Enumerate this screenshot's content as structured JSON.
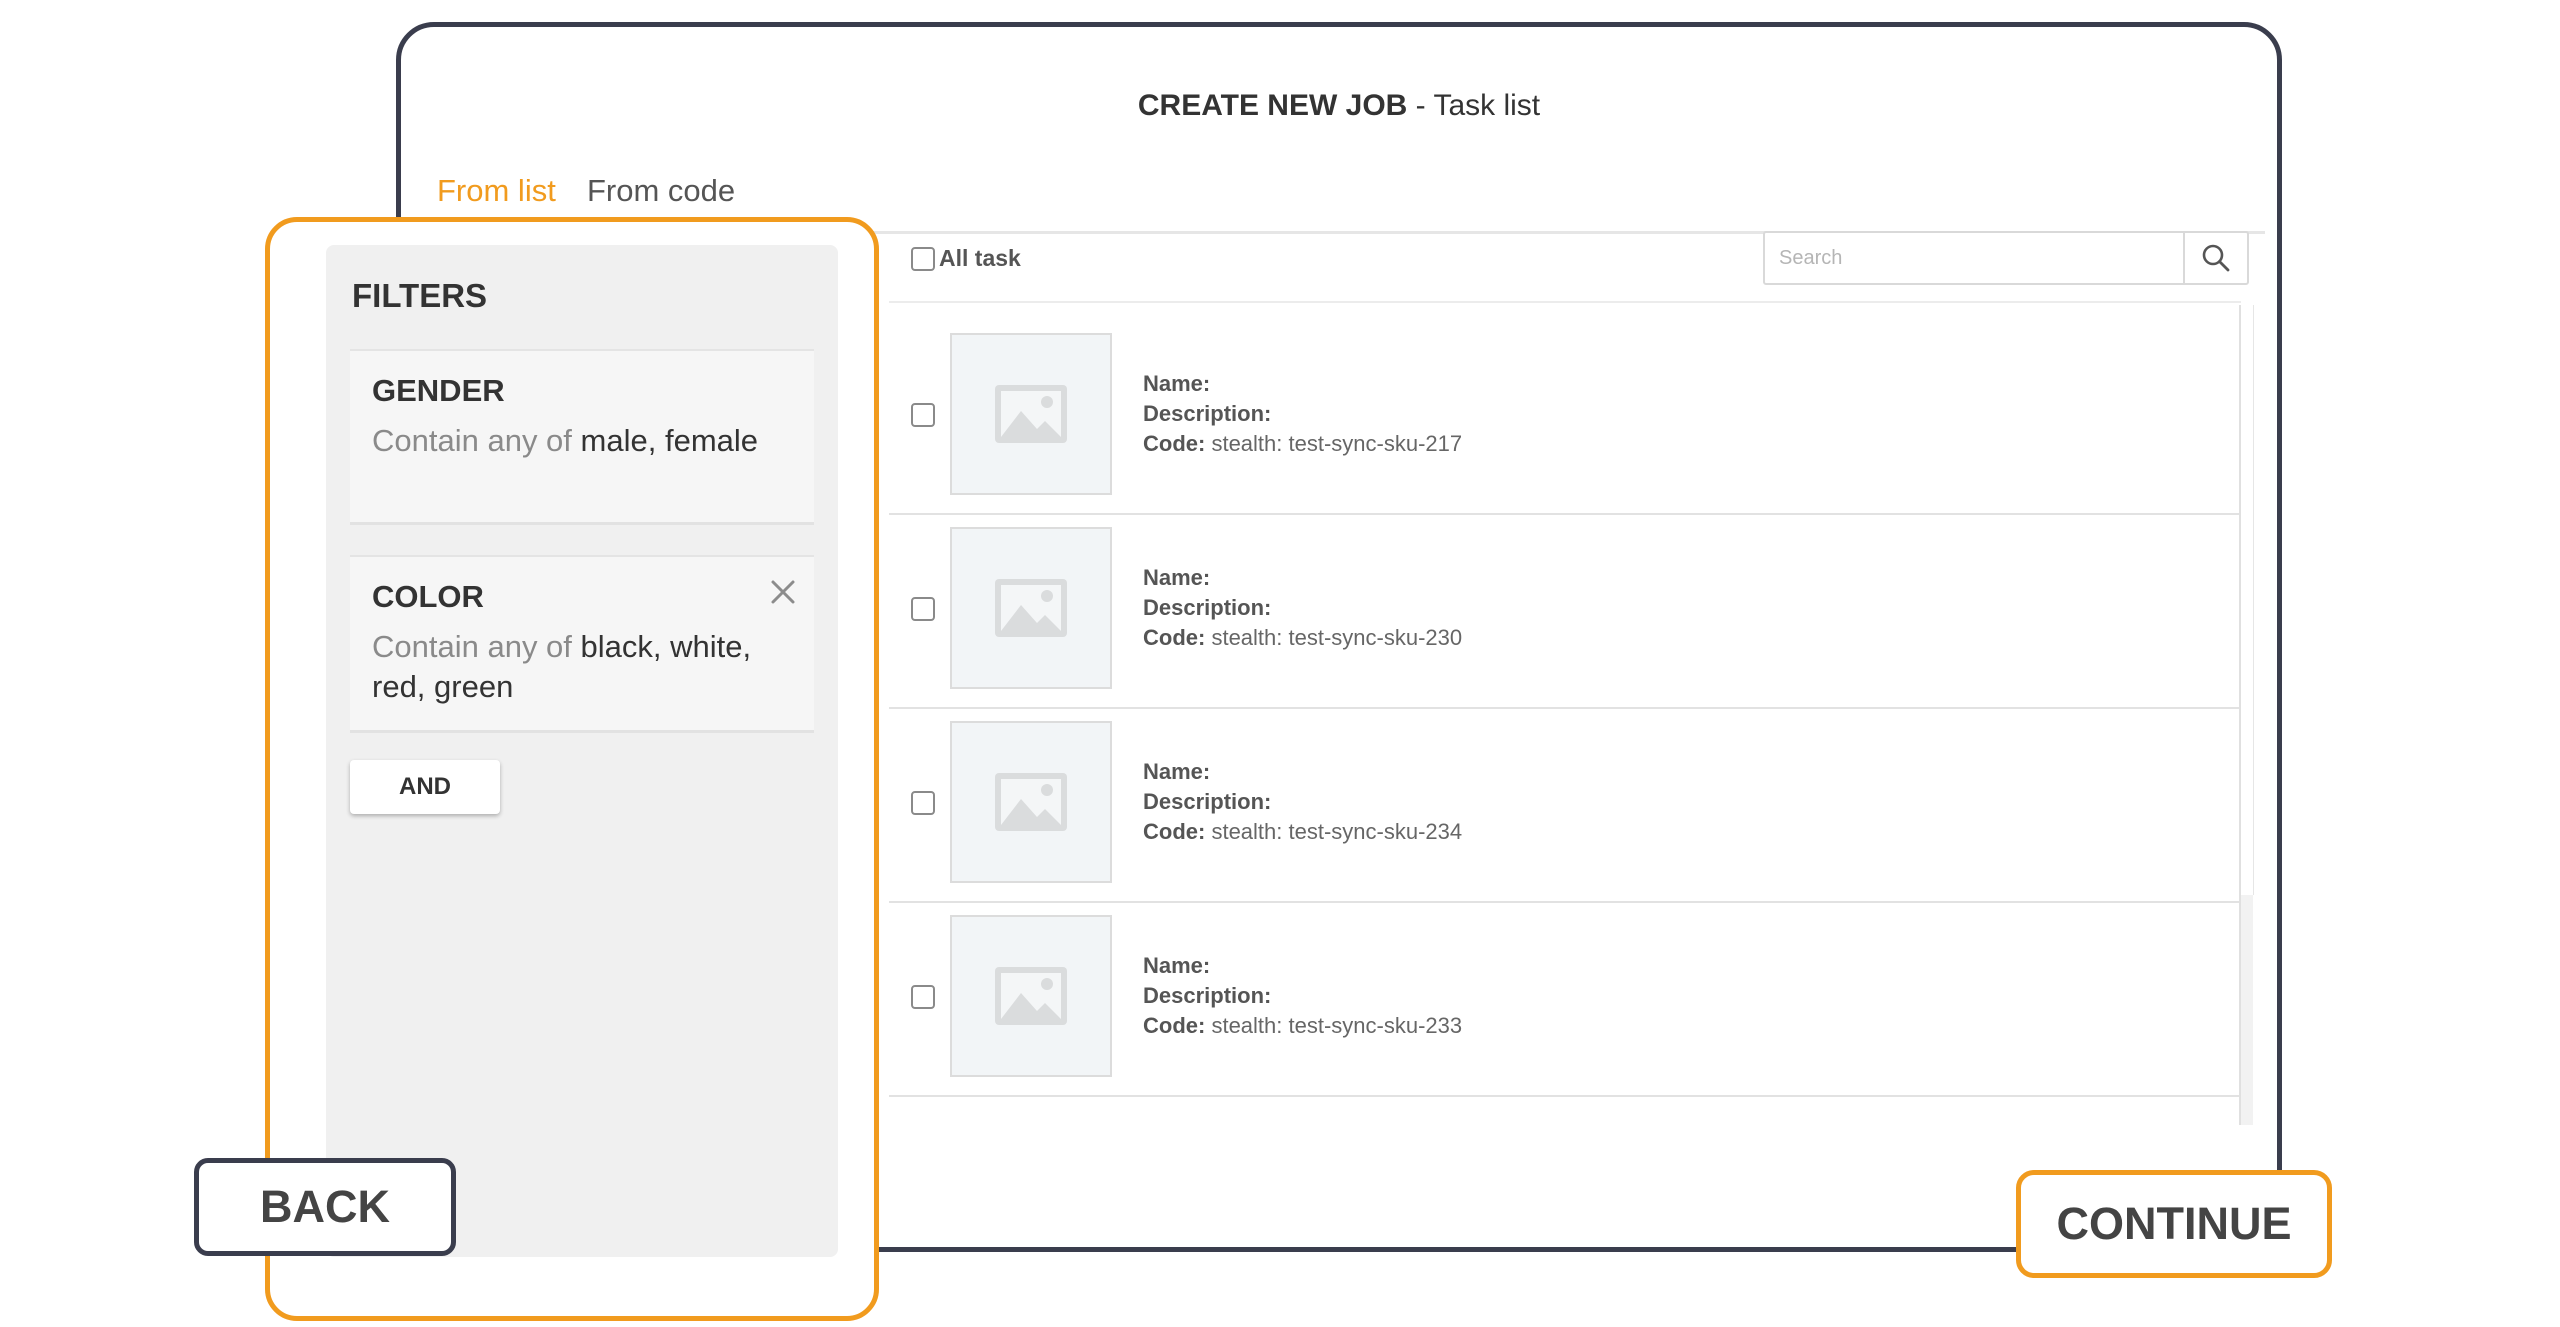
{
  "header": {
    "title_bold": "CREATE NEW JOB",
    "title_rest": " - Task list"
  },
  "tabs": [
    {
      "label": "From list",
      "active": true
    },
    {
      "label": "From code",
      "active": false
    }
  ],
  "toolbar": {
    "all_task_label": "All task",
    "all_task_checked": false,
    "search_placeholder": "Search",
    "search_icon": "search-icon"
  },
  "tasks": [
    {
      "name_label": "Name:",
      "name": "",
      "description_label": "Description:",
      "description": "",
      "code_label": "Code:",
      "code": "stealth: test-sync-sku-217",
      "checked": false
    },
    {
      "name_label": "Name:",
      "name": "",
      "description_label": "Description:",
      "description": "",
      "code_label": "Code:",
      "code": "stealth: test-sync-sku-230",
      "checked": false
    },
    {
      "name_label": "Name:",
      "name": "",
      "description_label": "Description:",
      "description": "",
      "code_label": "Code:",
      "code": "stealth: test-sync-sku-234",
      "checked": false
    },
    {
      "name_label": "Name:",
      "name": "",
      "description_label": "Description:",
      "description": "",
      "code_label": "Code:",
      "code": "stealth: test-sync-sku-233",
      "checked": false
    }
  ],
  "filters": {
    "title": "FILTERS",
    "items": [
      {
        "name": "GENDER",
        "operator": "Contain any of",
        "values": "male, female",
        "removable": false
      },
      {
        "name": "COLOR",
        "operator": "Contain any of",
        "values": "black, white, red, green",
        "removable": true
      }
    ],
    "and_label": "AND"
  },
  "actions": {
    "back_label": "BACK",
    "continue_label": "CONTINUE"
  },
  "colors": {
    "accent": "#f19b1e",
    "frame": "#3a3d4d",
    "panel_bg": "#f0f0f0"
  },
  "icons": {
    "thumbnail": "image-placeholder-icon",
    "remove": "close-icon"
  }
}
